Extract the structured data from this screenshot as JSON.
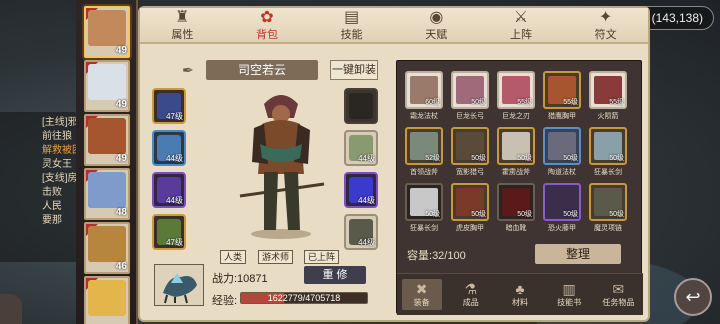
{
  "coord": "(143,138)",
  "quest_lines": [
    "[主线]邪狼兵",
    "前往狼",
    "解救被困",
    "灵女王",
    "[支线]房屋",
    "击败",
    "人民",
    "要那"
  ],
  "tabs": [
    {
      "label": "属性",
      "icon": "character-icon",
      "active": false
    },
    {
      "label": "背包",
      "icon": "backpack-icon",
      "active": true
    },
    {
      "label": "技能",
      "icon": "skill-book-icon",
      "active": false
    },
    {
      "label": "天赋",
      "icon": "talent-eye-icon",
      "active": false
    },
    {
      "label": "上阵",
      "icon": "formation-swords-icon",
      "active": false
    },
    {
      "label": "符文",
      "icon": "rune-icon",
      "active": false
    }
  ],
  "heroes": [
    {
      "level": "49",
      "selected": true,
      "color": "#c28a5a"
    },
    {
      "level": "49",
      "selected": false,
      "color": "#d9e0e8"
    },
    {
      "level": "49",
      "selected": false,
      "color": "#a5562f"
    },
    {
      "level": "48",
      "selected": false,
      "color": "#7f9bcb"
    },
    {
      "level": "46",
      "selected": false,
      "color": "#b7853d"
    },
    {
      "level": "",
      "selected": false,
      "color": "#e2b64a"
    }
  ],
  "character": {
    "name": "司空若云",
    "unequip_label": "一键卸装",
    "roles": [
      "人类",
      "游术师",
      "已上阵"
    ],
    "power_label": "战力:10871",
    "rebuild_label": "重 修",
    "exp_label": "经验:",
    "exp_text": "1622779/4705718",
    "exp_fraction": 0.345
  },
  "equip_left": [
    {
      "level": "47级",
      "quality": "gold",
      "color": "#3a4b8c"
    },
    {
      "level": "44级",
      "quality": "blue",
      "color": "#4a7cb3"
    },
    {
      "level": "44级",
      "quality": "purple",
      "color": "#5a3a9a"
    },
    {
      "level": "47级",
      "quality": "gold",
      "color": "#5a7a3a"
    }
  ],
  "equip_right": [
    {
      "level": "",
      "quality": "dark",
      "color": "#2a2622"
    },
    {
      "level": "44级",
      "quality": "grey",
      "color": "#8a9a70"
    },
    {
      "level": "44级",
      "quality": "purple",
      "color": "#3a3acb"
    },
    {
      "level": "44级",
      "quality": "grey",
      "color": "#5a5a4a"
    }
  ],
  "bag_items": [
    {
      "name": "霜龙法杖",
      "level": "60级",
      "quality": "grey",
      "color": "#9a7a6a"
    },
    {
      "name": "巨龙长弓",
      "level": "50级",
      "quality": "grey",
      "color": "#a06a7a"
    },
    {
      "name": "巨龙之刃",
      "level": "55级",
      "quality": "grey",
      "color": "#b55a6a"
    },
    {
      "name": "猎鹰胸甲",
      "level": "55级",
      "quality": "gold",
      "color": "#a5562f"
    },
    {
      "name": "火陨箭",
      "level": "55级",
      "quality": "grey",
      "color": "#8a3a3a"
    },
    {
      "name": "首领战斧",
      "level": "52级",
      "quality": "gold",
      "color": "#7a8a7a"
    },
    {
      "name": "宽影猎弓",
      "level": "50级",
      "quality": "gold",
      "color": "#5a4a3a"
    },
    {
      "name": "霍雳战斧",
      "level": "50级",
      "quality": "gold",
      "color": "#c8c0b0"
    },
    {
      "name": "陶道法杖",
      "level": "50级",
      "quality": "blue",
      "color": "#6a6a7a"
    },
    {
      "name": "狂暴长剑",
      "level": "50级",
      "quality": "gold",
      "color": "#8aa0a8"
    },
    {
      "name": "狂暴长剑",
      "level": "50级",
      "quality": "dark",
      "color": "#c8c8c8"
    },
    {
      "name": "虎皮胸甲",
      "level": "50级",
      "quality": "gold",
      "color": "#7a3a2a"
    },
    {
      "name": "暗血靴",
      "level": "50级",
      "quality": "dark",
      "color": "#5a1a1a"
    },
    {
      "name": "恐火藤甲",
      "level": "50级",
      "quality": "purple",
      "color": "#3a2e4b"
    },
    {
      "name": "魔灵项链",
      "level": "50级",
      "quality": "gold",
      "color": "#5a5a4a"
    }
  ],
  "capacity_label": "容量:",
  "capacity_value": "32/100",
  "sort_label": "整理",
  "bag_tabs": [
    {
      "label": "装备",
      "icon": "equipment-icon",
      "active": true
    },
    {
      "label": "成品",
      "icon": "product-icon",
      "active": false
    },
    {
      "label": "材料",
      "icon": "material-icon",
      "active": false
    },
    {
      "label": "技能书",
      "icon": "skillbook-icon",
      "active": false
    },
    {
      "label": "任务物品",
      "icon": "quest-item-icon",
      "active": false
    }
  ]
}
